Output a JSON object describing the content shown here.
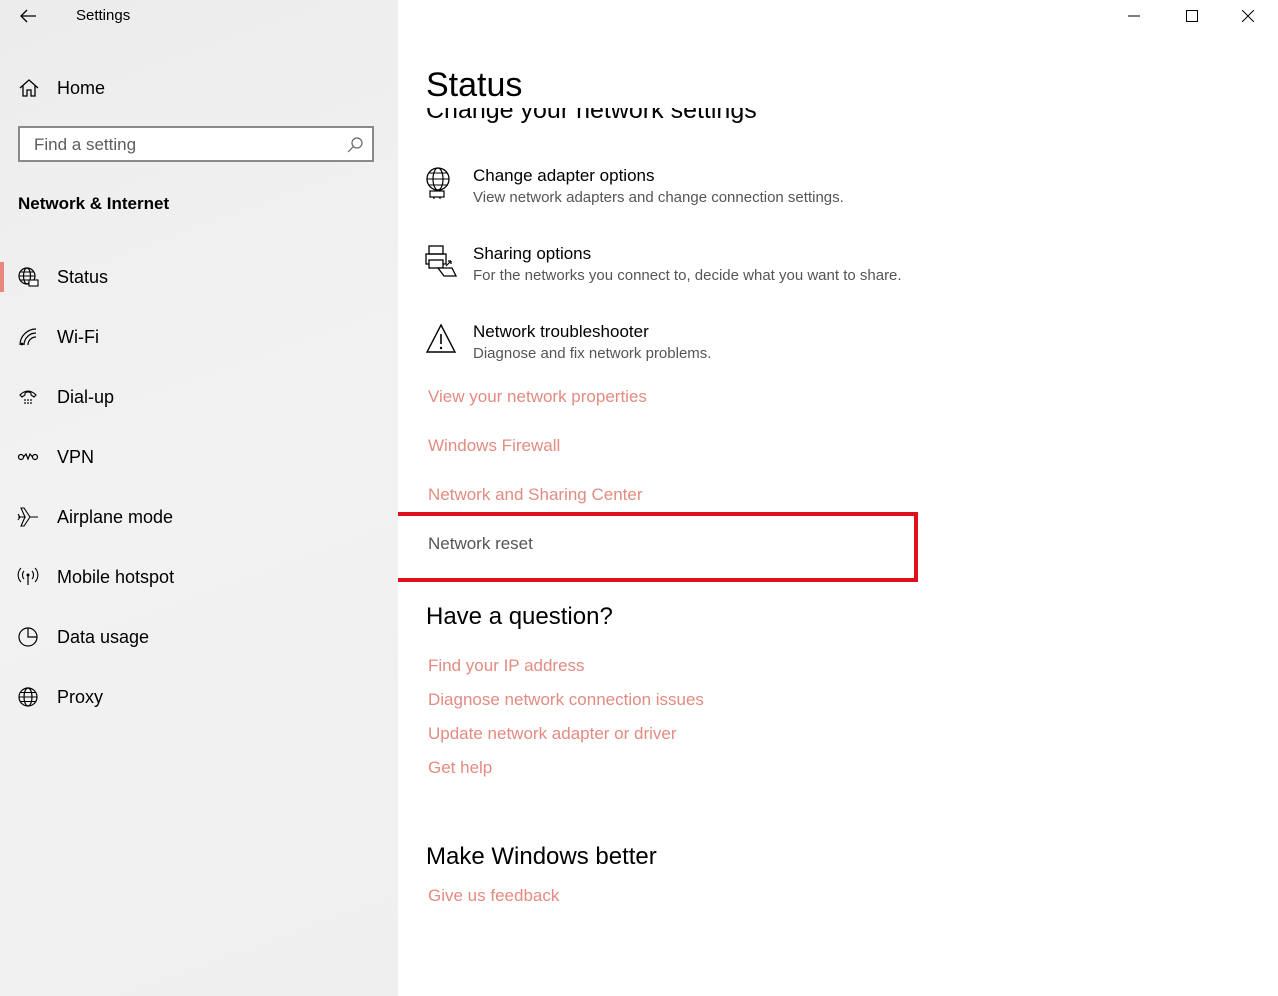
{
  "window": {
    "title": "Settings"
  },
  "sidebar": {
    "home_label": "Home",
    "search": {
      "placeholder": "Find a setting",
      "value": ""
    },
    "section_title": "Network & Internet",
    "items": [
      {
        "label": "Status",
        "icon": "status-globe-icon",
        "selected": true
      },
      {
        "label": "Wi-Fi",
        "icon": "wifi-icon",
        "selected": false
      },
      {
        "label": "Dial-up",
        "icon": "dialup-icon",
        "selected": false
      },
      {
        "label": "VPN",
        "icon": "vpn-icon",
        "selected": false
      },
      {
        "label": "Airplane mode",
        "icon": "airplane-icon",
        "selected": false
      },
      {
        "label": "Mobile hotspot",
        "icon": "hotspot-icon",
        "selected": false
      },
      {
        "label": "Data usage",
        "icon": "data-usage-icon",
        "selected": false
      },
      {
        "label": "Proxy",
        "icon": "proxy-globe-icon",
        "selected": false
      }
    ]
  },
  "main": {
    "page_title": "Status",
    "cut_heading": "Change your network settings",
    "options": [
      {
        "title": "Change adapter options",
        "desc": "View network adapters and change connection settings.",
        "icon": "adapter-icon"
      },
      {
        "title": "Sharing options",
        "desc": "For the networks you connect to, decide what you want to share.",
        "icon": "sharing-icon"
      },
      {
        "title": "Network troubleshooter",
        "desc": "Diagnose and fix network problems.",
        "icon": "warning-icon"
      }
    ],
    "links": [
      "View your network properties",
      "Windows Firewall",
      "Network and Sharing Center",
      "Network reset"
    ],
    "question_heading": "Have a question?",
    "question_links": [
      "Find your IP address",
      "Diagnose network connection issues",
      "Update network adapter or driver",
      "Get help"
    ],
    "better_heading": "Make Windows better",
    "feedback_link": "Give us feedback"
  },
  "colors": {
    "accent": "#e38b81",
    "selection_indicator": "#e8877e",
    "highlight_box": "#e0101a"
  }
}
